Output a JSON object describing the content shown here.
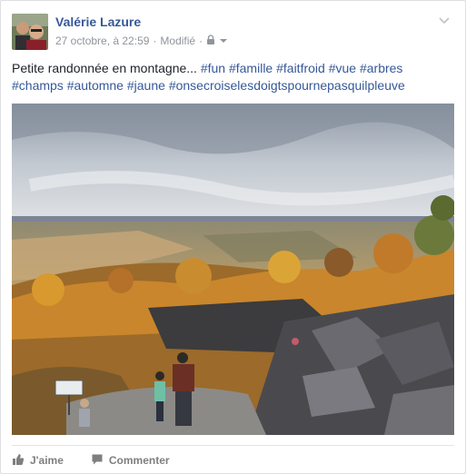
{
  "post": {
    "author": "Valérie Lazure",
    "timestamp": "27 octobre, à 22:59",
    "separator": "·",
    "edited": "Modifié",
    "privacy_icon": "lock-icon",
    "text": "Petite randonnée en montagne...",
    "hashtags": [
      "#fun",
      "#famille",
      "#faitfroid",
      "#vue",
      "#arbres",
      "#champs",
      "#automne",
      "#jaune",
      "#onsecroiselesdoigtspournepasquilpleuve"
    ]
  },
  "actions": {
    "like_label": "J'aime",
    "comment_label": "Commenter"
  },
  "colors": {
    "link": "#365899",
    "meta": "#90949c",
    "text": "#1d2129",
    "action": "#7f7f7f"
  }
}
